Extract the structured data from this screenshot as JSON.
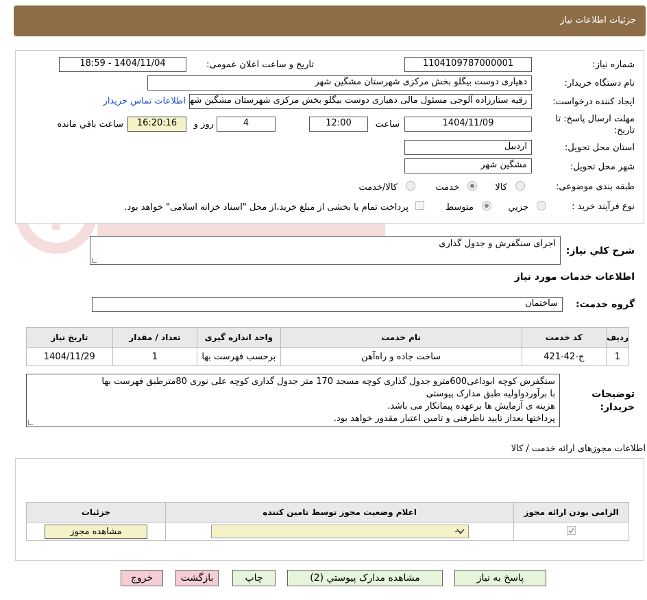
{
  "header": {
    "title": "جزئیات اطلاعات نیاز"
  },
  "form": {
    "need_number_label": "شماره نیاز:",
    "need_number": "1104109787000001",
    "announce_label": "تاریخ و ساعت اعلان عمومی:",
    "announce_value": "1404/11/04 - 18:59",
    "buyer_org_label": "نام دستگاه خریدار:",
    "buyer_org": "دهیاری دوست بیگلو بخش مرکزی شهرستان مشگین شهر",
    "creator_label": "ایجاد کننده درخواست:",
    "creator": "رقیه ستارزاده آلوجی مسئول مالی دهیاری دوست بیگلو بخش مرکزی شهرستان مشگین شهر",
    "contact_link": "اطلاعات تماس خریدار",
    "deadline_label": "مهلت ارسال پاسخ: تا تاریخ:",
    "deadline_date": "1404/11/09",
    "time_label": "ساعت",
    "deadline_time": "12:00",
    "days_value": "4",
    "days_label": "روز و",
    "remaining_time": "16:20:16",
    "remaining_label": "ساعت باقي مانده",
    "province_label": "استان محل تحویل:",
    "province": "اردبیل",
    "city_label": "شهر محل تحویل:",
    "city": "مشگین شهر",
    "category_label": "طبقه بندی موضوعی:",
    "category_options": [
      "کالا",
      "خدمت",
      "کالا/خدمت"
    ],
    "process_label": "نوع فرآیند خرید :",
    "process_options": [
      "جزیي",
      "متوسط"
    ],
    "payment_note": "پرداخت تمام یا بخشی از مبلغ خرید،از محل \"اسناد خزانه اسلامی\" خواهد بود."
  },
  "summary": {
    "label": "شرح کلي نیاز:",
    "value": "اجرای سنگفرش و جدول گذاری"
  },
  "services_title": "اطلاعات خدمات مورد نیاز",
  "service_group": {
    "label": "گروه خدمت:",
    "value": "ساختمان"
  },
  "service_table": {
    "headers": [
      "ردیف",
      "کد خدمت",
      "نام خدمت",
      "واحد اندازه گیری",
      "تعداد / مقدار",
      "تاریخ نیاز"
    ],
    "rows": [
      [
        "1",
        "ج-42-421",
        "ساخت جاده و راه‌آهن",
        "برحسب فهرست بها",
        "1",
        "1404/11/29"
      ]
    ]
  },
  "buyer_notes": {
    "label": "توضیحات خریدار:",
    "lines": [
      "سنگفرش  کوچه ابوداغی600مترو جدول گذاری کوچه مسجد 170 متر جدول گذاری کوچه علی نوری 80مترطبق فهرست بها",
      "با برآوردواولیه طبق مدارک پیوستی",
      "هزینه ی آزمایش ها برعهده پیمانکار می باشد.",
      "پرداختها بعداز تایید ناظرفنی و تامین اعتبار مقدور خواهد بود."
    ]
  },
  "permits": {
    "title": "اطلاعات مجوزهای ارائه خدمت / کالا",
    "headers": [
      "الزامی بودن ارائه مجوز",
      "اعلام وضعیت مجوز توسط تامین کننده",
      "جزئیات"
    ],
    "select_value": "--",
    "view_button": "مشاهده مجوز"
  },
  "buttons": {
    "reply": "پاسخ به نیاز",
    "attachments": "مشاهده مدارک پیوستي (2)",
    "print": "چاپ",
    "back": "بازگشت",
    "exit": "خروج"
  },
  "colors": {
    "header_bg": "#8c6d46",
    "green_button": "#e6f4da",
    "pink_button": "#f5cdd4",
    "yellow_field": "#f5f2c8"
  }
}
